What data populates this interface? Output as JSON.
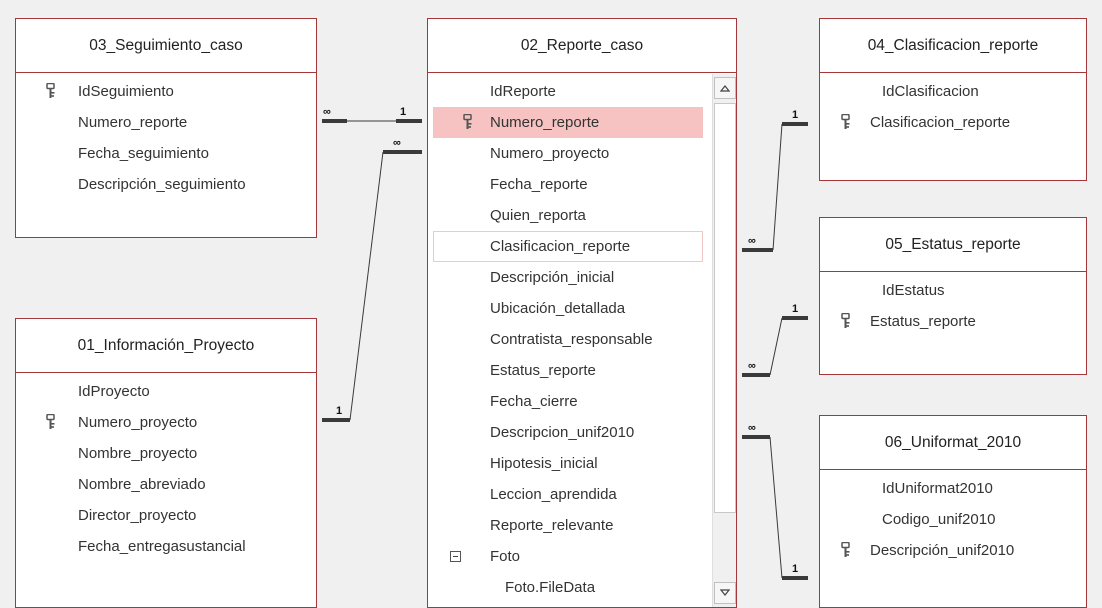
{
  "tables": [
    {
      "title": "03_Seguimiento_caso",
      "fields": [
        {
          "name": "IdSeguimiento",
          "key": true
        },
        {
          "name": "Numero_reporte",
          "key": false
        },
        {
          "name": "Fecha_seguimiento",
          "key": false
        },
        {
          "name": "Descripción_seguimiento",
          "key": false
        }
      ]
    },
    {
      "title": "01_Información_Proyecto",
      "fields": [
        {
          "name": "IdProyecto",
          "key": false
        },
        {
          "name": "Numero_proyecto",
          "key": true
        },
        {
          "name": "Nombre_proyecto",
          "key": false
        },
        {
          "name": "Nombre_abreviado",
          "key": false
        },
        {
          "name": "Director_proyecto",
          "key": false
        },
        {
          "name": "Fecha_entregasustancial",
          "key": false
        }
      ]
    },
    {
      "title": "02_Reporte_caso",
      "selected_field": "Numero_reporte",
      "outlined_field": "Clasificacion_reporte",
      "expanded_field": "Foto",
      "fields": [
        {
          "name": "IdReporte",
          "key": false
        },
        {
          "name": "Numero_reporte",
          "key": true
        },
        {
          "name": "Numero_proyecto",
          "key": false
        },
        {
          "name": "Fecha_reporte",
          "key": false
        },
        {
          "name": "Quien_reporta",
          "key": false
        },
        {
          "name": "Clasificacion_reporte",
          "key": false
        },
        {
          "name": "Descripción_inicial",
          "key": false
        },
        {
          "name": "Ubicación_detallada",
          "key": false
        },
        {
          "name": "Contratista_responsable",
          "key": false
        },
        {
          "name": "Estatus_reporte",
          "key": false
        },
        {
          "name": "Fecha_cierre",
          "key": false
        },
        {
          "name": "Descripcion_unif2010",
          "key": false
        },
        {
          "name": "Hipotesis_inicial",
          "key": false
        },
        {
          "name": "Leccion_aprendida",
          "key": false
        },
        {
          "name": "Reporte_relevante",
          "key": false
        },
        {
          "name": "Foto",
          "key": false
        },
        {
          "name": "Foto.FileData",
          "key": false
        }
      ]
    },
    {
      "title": "04_Clasificacion_reporte",
      "fields": [
        {
          "name": "IdClasificacion",
          "key": false
        },
        {
          "name": "Clasificacion_reporte",
          "key": true
        }
      ]
    },
    {
      "title": "05_Estatus_reporte",
      "fields": [
        {
          "name": "IdEstatus",
          "key": false
        },
        {
          "name": "Estatus_reporte",
          "key": true
        }
      ]
    },
    {
      "title": "06_Uniformat_2010",
      "fields": [
        {
          "name": "IdUniformat2010",
          "key": false
        },
        {
          "name": "Codigo_unif2010",
          "key": false
        },
        {
          "name": "Descripción_unif2010",
          "key": true
        }
      ]
    }
  ],
  "relationships": [
    {
      "from_table": "02_Reporte_caso",
      "from_field": "Numero_reporte",
      "from_end": "1",
      "to_table": "03_Seguimiento_caso",
      "to_field": "Numero_reporte",
      "to_end": "∞"
    },
    {
      "from_table": "01_Información_Proyecto",
      "from_field": "Numero_proyecto",
      "from_end": "1",
      "to_table": "02_Reporte_caso",
      "to_field": "Numero_proyecto",
      "to_end": "∞"
    },
    {
      "from_table": "04_Clasificacion_reporte",
      "from_field": "Clasificacion_reporte",
      "from_end": "1",
      "to_table": "02_Reporte_caso",
      "to_field": "Clasificacion_reporte",
      "to_end": "∞"
    },
    {
      "from_table": "05_Estatus_reporte",
      "from_field": "Estatus_reporte",
      "from_end": "1",
      "to_table": "02_Reporte_caso",
      "to_field": "Estatus_reporte",
      "to_end": "∞"
    },
    {
      "from_table": "06_Uniformat_2010",
      "from_field": "Descripción_unif2010",
      "from_end": "1",
      "to_table": "02_Reporte_caso",
      "to_field": "Descripcion_unif2010",
      "to_end": "∞"
    }
  ],
  "colors": {
    "border": "#a4373a",
    "selected_row": "#f6c3c2",
    "canvas": "#f0f0f0",
    "text": "#333333",
    "line": "#3a3a3a"
  },
  "icons": {
    "key": "key-icon",
    "expand": "collapse-box-icon",
    "scroll_up": "scroll-up-arrow-icon",
    "scroll_down": "scroll-down-arrow-icon"
  }
}
